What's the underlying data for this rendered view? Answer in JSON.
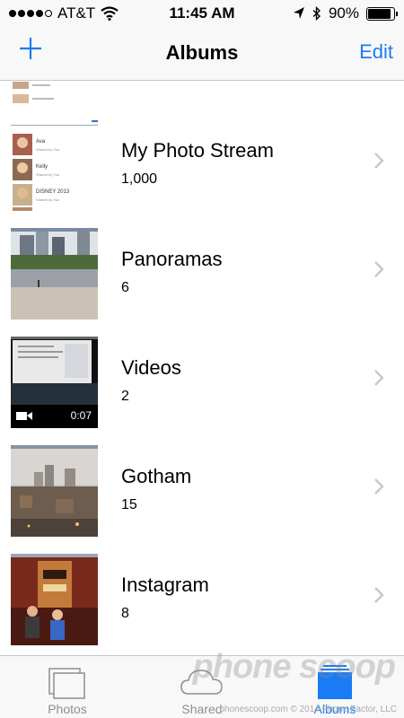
{
  "status_bar": {
    "carrier": "AT&T",
    "time": "11:45 AM",
    "battery_percent": "90%",
    "battery_level": 0.9,
    "signal_bars_filled": 4,
    "signal_bars_total": 5
  },
  "nav": {
    "add_icon": "plus-icon",
    "title": "Albums",
    "edit_label": "Edit",
    "accent_color": "#1a7cf5"
  },
  "albums": [
    {
      "name": "My Photo Stream",
      "count": "1,000",
      "thumb": "photo-stream-collage"
    },
    {
      "name": "Panoramas",
      "count": "6",
      "thumb": "city-plaza-photo"
    },
    {
      "name": "Videos",
      "count": "2",
      "thumb": "video-thumbnail",
      "duration": "0:07"
    },
    {
      "name": "Gotham",
      "count": "15",
      "thumb": "city-skyline-photo"
    },
    {
      "name": "Instagram",
      "count": "8",
      "thumb": "tiki-statue-photo"
    }
  ],
  "stream_thumb_labels": [
    "Shared by You",
    "Ava",
    "Shared by You",
    "Kelly",
    "Shared by You",
    "DISNEY 2013",
    "Shared by You"
  ],
  "tabs": [
    {
      "label": "Photos",
      "icon": "photos-stack-icon",
      "active": false
    },
    {
      "label": "Shared",
      "icon": "cloud-icon",
      "active": false
    },
    {
      "label": "Albums",
      "icon": "albums-icon",
      "active": true
    }
  ],
  "watermark": {
    "logo": "phone scoop",
    "text": "phonescoop.com  © 2014 Phone Factor, LLC"
  }
}
